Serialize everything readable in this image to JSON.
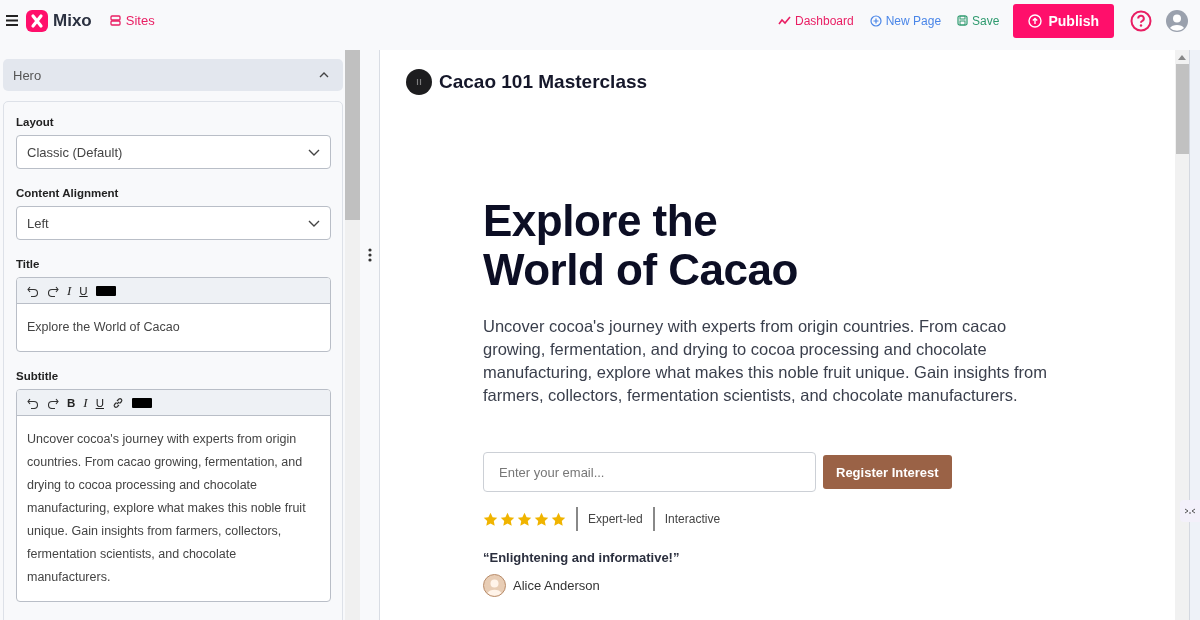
{
  "topbar": {
    "brand": "Mixo",
    "sites": "Sites",
    "actions": [
      {
        "kind": "dashboard",
        "label": "Dashboard"
      },
      {
        "kind": "new",
        "label": "New Page"
      },
      {
        "kind": "save",
        "label": "Save"
      }
    ],
    "publish": "Publish"
  },
  "sidebar": {
    "section": {
      "title": "Hero",
      "expanded": true
    },
    "fields": [
      {
        "kind": "select",
        "label": "Layout",
        "value": "Classic (Default)"
      },
      {
        "kind": "select",
        "label": "Content Alignment",
        "value": "Left"
      },
      {
        "kind": "editor",
        "label": "Title",
        "tools": [
          {
            "kind": "undo"
          },
          {
            "kind": "redo"
          },
          {
            "kind": "italic",
            "label": "I"
          },
          {
            "kind": "underline",
            "label": "U"
          },
          {
            "kind": "swatch",
            "color": "#000000"
          }
        ],
        "value": "Explore the World of Cacao"
      },
      {
        "kind": "editor",
        "label": "Subtitle",
        "tools": [
          {
            "kind": "undo"
          },
          {
            "kind": "redo"
          },
          {
            "kind": "bold",
            "label": "B"
          },
          {
            "kind": "italic",
            "label": "I"
          },
          {
            "kind": "underline",
            "label": "U"
          },
          {
            "kind": "link"
          },
          {
            "kind": "swatch",
            "color": "#000000"
          }
        ],
        "value": "Uncover cocoa's journey with experts from origin countries. From cacao growing, fermentation, and drying to cocoa processing and chocolate manufacturing, explore what makes this noble fruit unique. Gain insights from farmers, collectors, fermentation scientists, and chocolate manufacturers."
      }
    ]
  },
  "preview": {
    "site_name": "Cacao 101 Masterclass",
    "heading_lines": [
      "Explore the",
      "World of Cacao"
    ],
    "subtitle": "Uncover cocoa's journey with experts from origin countries. From cacao growing, fermentation, and drying to cocoa processing and chocolate manufacturing, explore what makes this noble fruit unique. Gain insights from farmers, collectors, fermentation scientists, and chocolate manufacturers.",
    "email": {
      "placeholder": "Enter your email..."
    },
    "cta": "Register Interest",
    "stars": 5,
    "badges": [
      "Expert-led",
      "Interactive"
    ],
    "quote": "“Enlightening and informative!”",
    "author": "Alice Anderson"
  }
}
